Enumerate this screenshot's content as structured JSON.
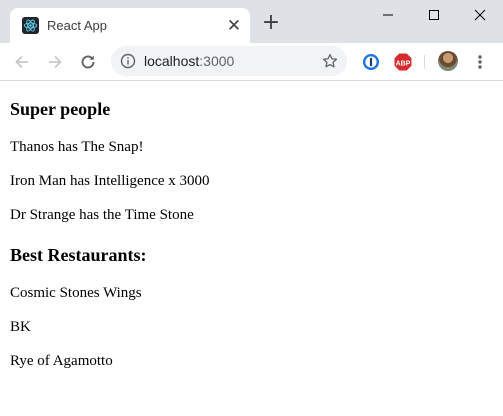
{
  "browser": {
    "tab": {
      "title": "React App",
      "close_glyph": "✕",
      "icon": "react-logo-icon"
    },
    "new_tab_glyph": "+",
    "window_controls": [
      "minimize-icon",
      "maximize-icon",
      "close-icon"
    ],
    "toolbar": {
      "icons": [
        "back-arrow-icon",
        "forward-arrow-icon",
        "reload-icon"
      ],
      "address": {
        "host": "localhost",
        "port": ":3000",
        "icon": "info-icon"
      },
      "bookmark_icon": "star-icon",
      "extensions": [
        {
          "name": "1password-icon"
        },
        {
          "name": "adblock-plus-icon",
          "label": "ABP"
        }
      ],
      "profile_icon": "avatar",
      "menu_icon": "more-vert-icon"
    },
    "colors": {
      "tabstrip": "#dee1e6",
      "omnibox": "#f1f3f4",
      "react_blue": "#61dafb",
      "abp_red": "#d62b2b",
      "onepassword_blue": "#1a73e8"
    }
  },
  "page": {
    "super_people": {
      "heading": "Super people",
      "items": [
        "Thanos has The Snap!",
        "Iron Man has Intelligence x 3000",
        "Dr Strange has the Time Stone"
      ]
    },
    "restaurants": {
      "heading": "Best Restaurants:",
      "items": [
        "Cosmic Stones Wings",
        "BK",
        "Rye of Agamotto"
      ]
    }
  }
}
